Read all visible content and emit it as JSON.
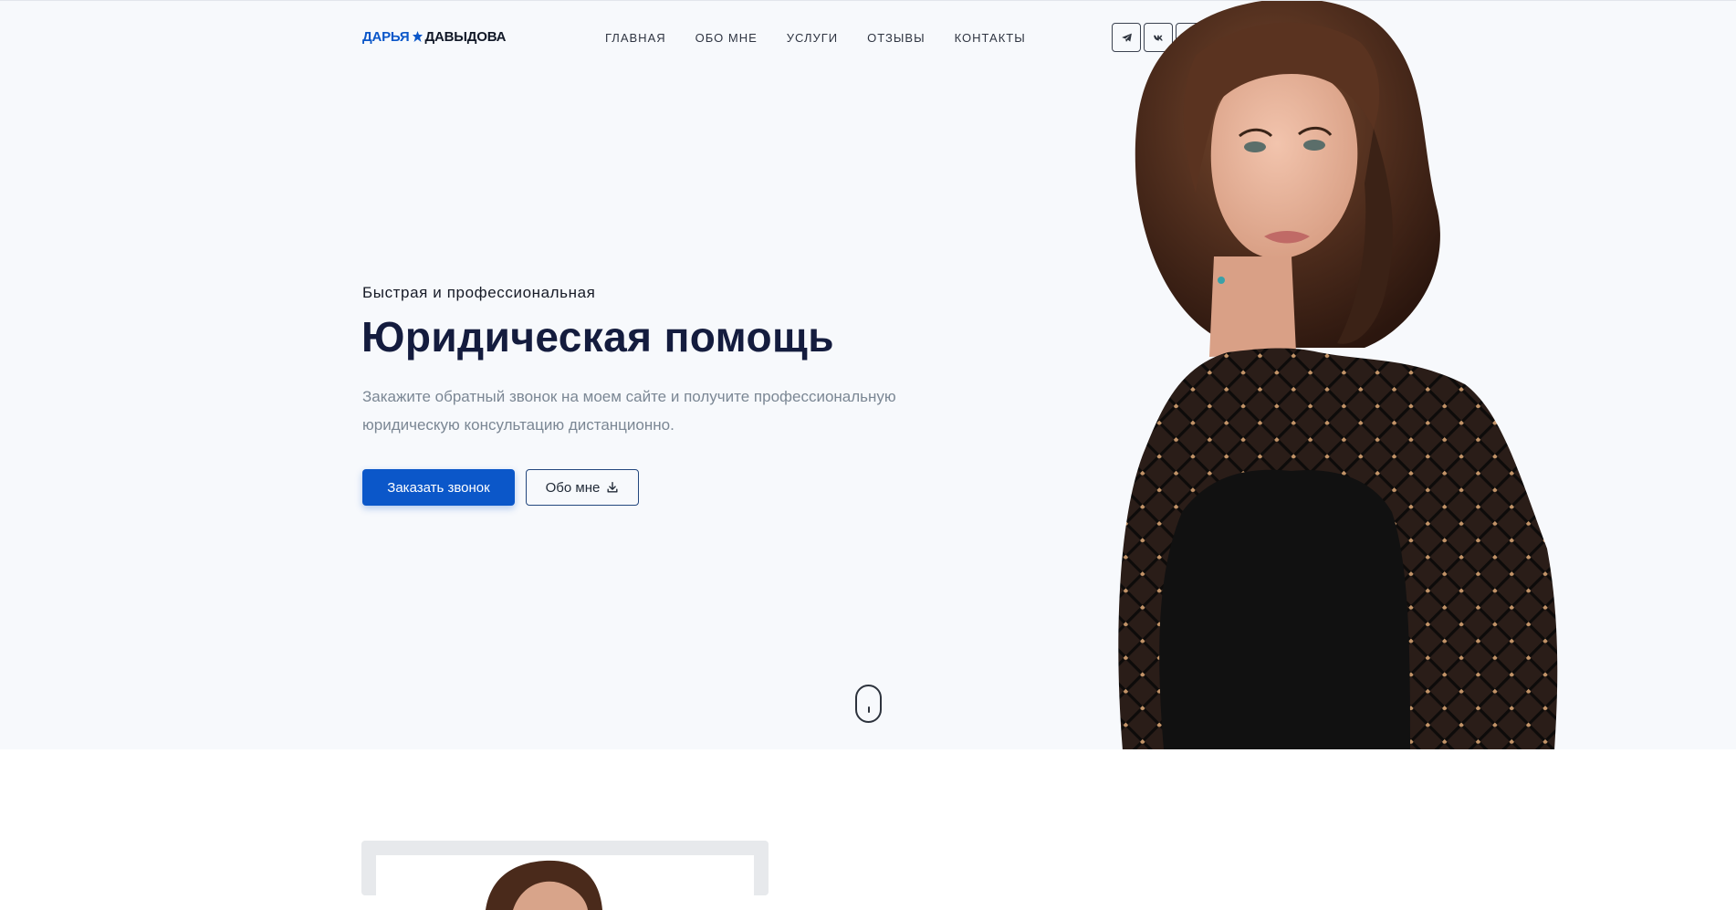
{
  "header": {
    "logo": {
      "first_name": "ДАРЬЯ",
      "last_name": "ДАВЫДОВА",
      "brand_color": "#0b57c9"
    },
    "nav": [
      {
        "label": "ГЛАВНАЯ"
      },
      {
        "label": "ОБО МНЕ"
      },
      {
        "label": "УСЛУГИ"
      },
      {
        "label": "ОТЗЫВЫ"
      },
      {
        "label": "КОНТАКТЫ"
      }
    ],
    "social": [
      {
        "icon": "telegram-icon"
      },
      {
        "icon": "vk-icon"
      },
      {
        "icon": "whatsapp-icon"
      }
    ]
  },
  "hero": {
    "kicker": "Быстрая и профессиональная",
    "title": "Юридическая помощь",
    "lead": "Закажите обратный звонок на моем сайте и получите профессиональную юридическую консультацию дистанционно.",
    "primary_button": "Заказать звонок",
    "secondary_button": "Обо мне",
    "secondary_button_icon": "download-icon",
    "scroll_indicator_icon": "mouse-scroll-icon",
    "portrait": "woman-portrait-photo",
    "background_color": "#f7f9fc",
    "title_color": "#141c3e"
  },
  "about": {
    "photo": "woman-portrait-photo"
  }
}
